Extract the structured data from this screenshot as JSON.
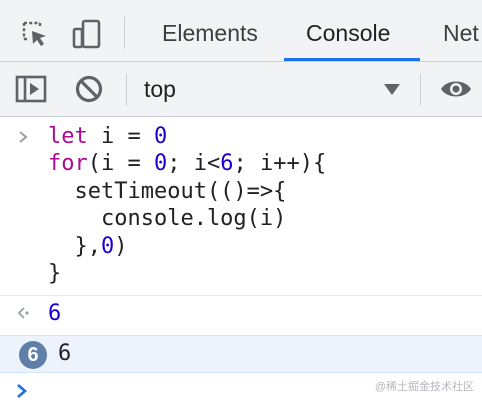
{
  "tabs": {
    "items": [
      {
        "label": "Elements",
        "active": false
      },
      {
        "label": "Console",
        "active": true
      },
      {
        "label": "Net",
        "active": false
      }
    ],
    "inspect_icon": "inspect-element-icon",
    "device_icon": "device-toolbar-icon"
  },
  "toolbar": {
    "sidebar_icon": "show-sidebar-icon",
    "clear_icon": "clear-console-icon",
    "context": "top",
    "eye_icon": "live-expression-eye-icon"
  },
  "console": {
    "code_lines": [
      [
        {
          "t": "let",
          "c": "kw"
        },
        {
          "t": " i = ",
          "c": "plain"
        },
        {
          "t": "0",
          "c": "num"
        }
      ],
      [
        {
          "t": "for",
          "c": "kw"
        },
        {
          "t": "(i = ",
          "c": "plain"
        },
        {
          "t": "0",
          "c": "num"
        },
        {
          "t": "; i<",
          "c": "plain"
        },
        {
          "t": "6",
          "c": "num"
        },
        {
          "t": "; i++){",
          "c": "plain"
        }
      ],
      [
        {
          "t": "  setTimeout(()=>{",
          "c": "plain"
        }
      ],
      [
        {
          "t": "    console.log(i)",
          "c": "plain"
        }
      ],
      [
        {
          "t": "  },",
          "c": "plain"
        },
        {
          "t": "0",
          "c": "num"
        },
        {
          "t": ")",
          "c": "plain"
        }
      ],
      [
        {
          "t": "}",
          "c": "plain"
        }
      ]
    ],
    "result_value": "6",
    "log_repeat_count": "6",
    "log_value": "6"
  },
  "watermark": "@稀土掘金技术社区",
  "colors": {
    "accent": "#1a73e8",
    "keyword": "#aa0d91",
    "number": "#1c00cf",
    "log_row_bg": "#edf3fd",
    "badge": "#5f7ea8"
  }
}
